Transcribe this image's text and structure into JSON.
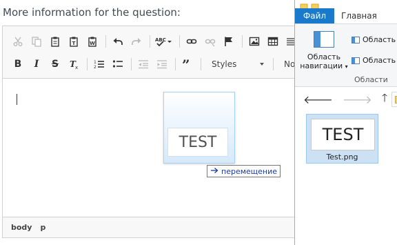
{
  "page": {
    "question_label": "More information for the question:"
  },
  "toolbar": {
    "styles_label": "Styles",
    "format_label": "Normal",
    "icons": {
      "cut": "cut-icon",
      "copy": "copy-icon",
      "paste": "paste-icon",
      "paste_text": "paste-text-icon",
      "paste_word": "paste-word-icon",
      "undo": "undo-icon",
      "redo": "redo-icon",
      "spellcheck": "spellcheck-icon",
      "link": "link-icon",
      "unlink": "unlink-icon",
      "anchor": "anchor-flag-icon",
      "image": "image-icon",
      "table": "table-icon",
      "hr": "horizontal-line-icon",
      "bold": "B",
      "italic": "I",
      "strike": "S",
      "remove_format": "remove-format-icon",
      "numbered_list": "numbered-list-icon",
      "bulleted_list": "bulleted-list-icon",
      "outdent": "outdent-icon",
      "indent": "indent-icon",
      "blockquote": "blockquote-icon"
    }
  },
  "drag": {
    "thumbnail_text": "TEST",
    "tooltip_text": "перемещение"
  },
  "statusbar": {
    "path": [
      "body",
      "p"
    ]
  },
  "explorer": {
    "tabs": {
      "file": "Файл",
      "home": "Главная"
    },
    "ribbon": {
      "nav_pane_label_line1": "Область",
      "nav_pane_label_line2": "навигации",
      "preview_pane_label": "Область",
      "details_pane_label": "Область",
      "group_label": "Области"
    },
    "file": {
      "thumbnail_text": "TEST",
      "name": "Test.png"
    },
    "colors": {
      "accent": "#1979ca",
      "selection": "#cce1f4"
    }
  }
}
